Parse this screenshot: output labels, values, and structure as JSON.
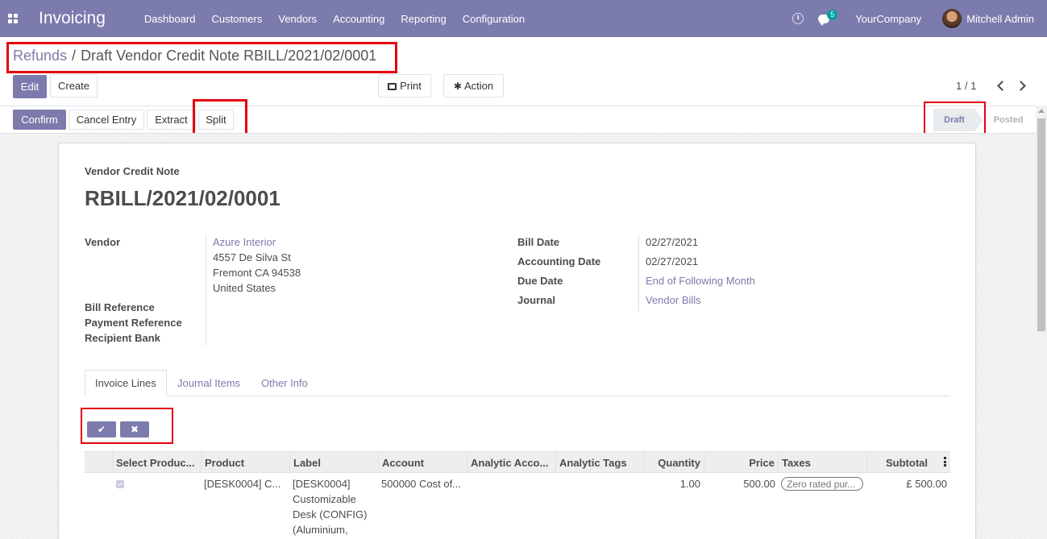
{
  "navbar": {
    "app_name": "Invoicing",
    "menu": [
      "Dashboard",
      "Customers",
      "Vendors",
      "Accounting",
      "Reporting",
      "Configuration"
    ],
    "badge_count": "5",
    "company": "YourCompany",
    "user": "Mitchell Admin",
    "color": "#7c7bad"
  },
  "breadcrumb": {
    "parent": "Refunds",
    "separator": "/",
    "current": "Draft Vendor Credit Note RBILL/2021/02/0001"
  },
  "control": {
    "edit": "Edit",
    "create": "Create",
    "print": "Print",
    "action": "Action",
    "pager": "1 / 1"
  },
  "statusbar": {
    "confirm": "Confirm",
    "cancel_entry": "Cancel Entry",
    "extract": "Extract",
    "split": "Split",
    "stages": [
      "Draft",
      "Posted"
    ],
    "active_stage": "Draft"
  },
  "document": {
    "type": "Vendor Credit Note",
    "name": "RBILL/2021/02/0001",
    "left_fields": {
      "vendor_label": "Vendor",
      "vendor_name": "Azure Interior",
      "vendor_address": [
        "4557 De Silva St",
        "Fremont CA 94538",
        "United States"
      ],
      "bill_reference_label": "Bill Reference",
      "payment_reference_label": "Payment Reference",
      "recipient_bank_label": "Recipient Bank"
    },
    "right_fields": {
      "bill_date_label": "Bill Date",
      "bill_date": "02/27/2021",
      "accounting_date_label": "Accounting Date",
      "accounting_date": "02/27/2021",
      "due_date_label": "Due Date",
      "due_date": "End of Following Month",
      "journal_label": "Journal",
      "journal": "Vendor Bills"
    }
  },
  "tabs": [
    "Invoice Lines",
    "Journal Items",
    "Other Info"
  ],
  "table": {
    "columns": [
      "Select Produc...",
      "Product",
      "Label",
      "Account",
      "Analytic Acco...",
      "Analytic Tags",
      "Quantity",
      "Price",
      "Taxes",
      "Subtotal"
    ],
    "rows": [
      {
        "selected": true,
        "product": "[DESK0004] C...",
        "label_lines": [
          "[DESK0004]",
          "Customizable",
          "Desk (CONFIG)",
          "(Aluminium,"
        ],
        "account": "500000 Cost of...",
        "analytic_account": "",
        "analytic_tags": "",
        "quantity": "1.00",
        "price": "500.00",
        "taxes": "Zero rated pur...",
        "subtotal": "£ 500.00"
      }
    ]
  }
}
